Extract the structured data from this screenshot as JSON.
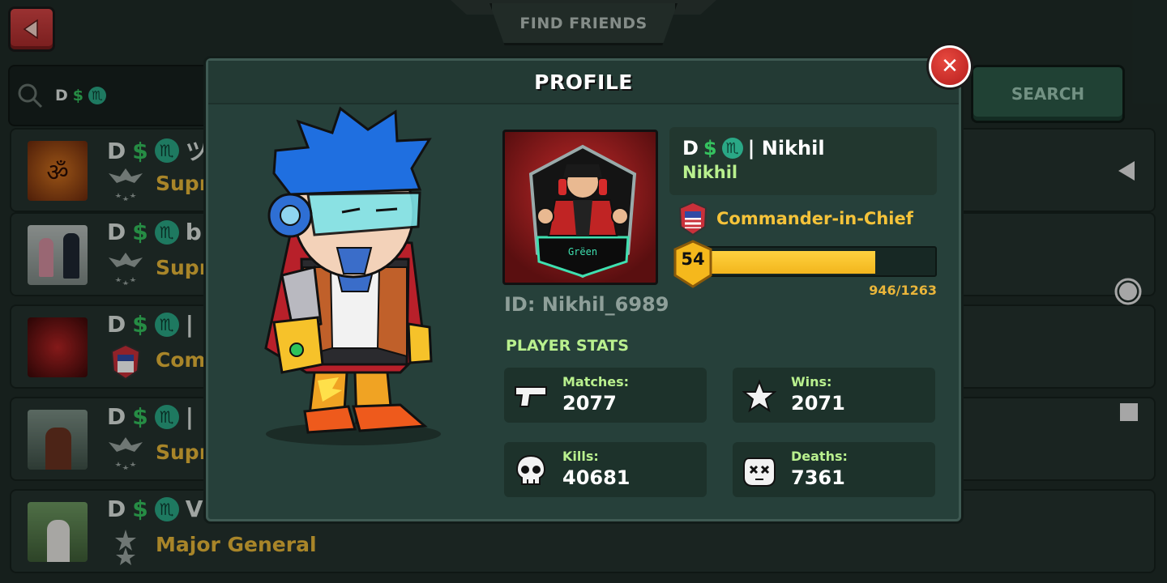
{
  "header": {
    "title": "FIND FRIENDS"
  },
  "search": {
    "query_parts": [
      "D",
      "$",
      "♏"
    ],
    "button_label": "SEARCH"
  },
  "list": {
    "rows": [
      {
        "name_parts": [
          "D",
          "$",
          "♏",
          "ツ"
        ],
        "rank": "Supre"
      },
      {
        "name_parts": [
          "D",
          "$",
          "♏",
          "b"
        ],
        "rank": "Supre"
      },
      {
        "name_parts": [
          "D",
          "$",
          "♏",
          "|"
        ],
        "rank": "Comm"
      },
      {
        "name_parts": [
          "D",
          "$",
          "♏",
          "|"
        ],
        "rank": "Supre"
      },
      {
        "name_parts": [
          "D",
          "$",
          "♏",
          "VI"
        ],
        "rank": "Major General"
      }
    ]
  },
  "profile": {
    "title": "PROFILE",
    "display_name": [
      "D",
      "$",
      "♏",
      "| Nikhil"
    ],
    "username": "Nikhil",
    "rank_title": "Commander-in-Chief",
    "level": "54",
    "xp_text": "946/1263",
    "xp_fraction": 0.749,
    "player_id": "ID: Nikhil_6989",
    "emblem_text": "Grëen",
    "stats_title": "PLAYER STATS",
    "stats": [
      {
        "label": "Matches:",
        "value": "2077",
        "icon": "pistol-icon"
      },
      {
        "label": "Wins:",
        "value": "2071",
        "icon": "star-icon"
      },
      {
        "label": "Kills:",
        "value": "40681",
        "icon": "skull-icon"
      },
      {
        "label": "Deaths:",
        "value": "7361",
        "icon": "dead-face-icon"
      }
    ]
  },
  "colors": {
    "accent_green": "#b9f08e",
    "gold": "#f5c33a",
    "danger": "#c42a2a"
  }
}
